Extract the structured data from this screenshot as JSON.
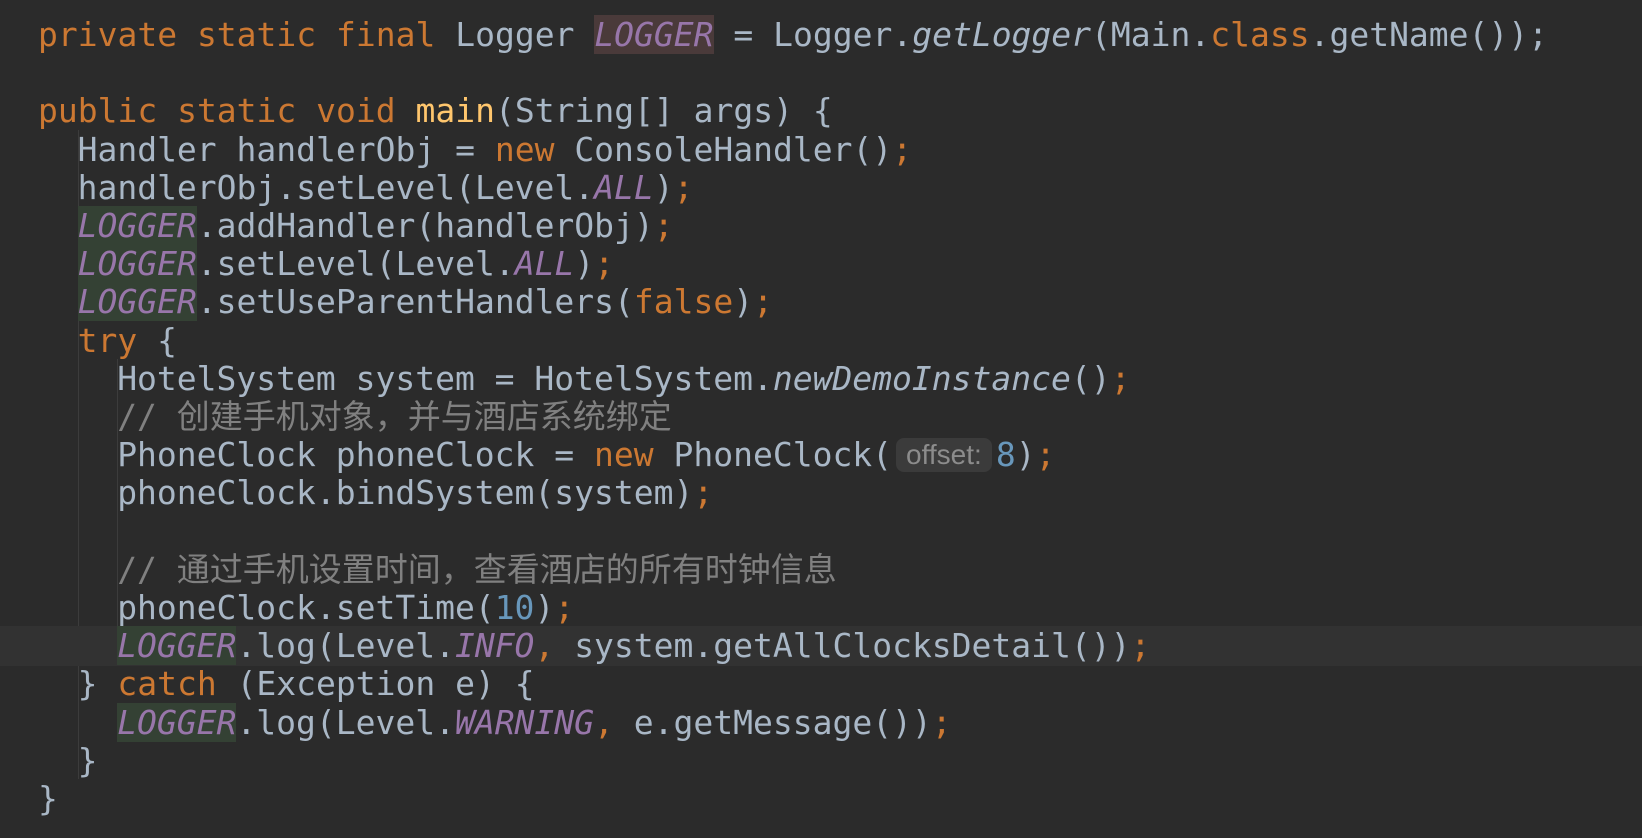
{
  "editor": {
    "lines": [
      {
        "indent": 1,
        "tokens": [
          {
            "t": "private static final ",
            "c": "kw"
          },
          {
            "t": "Logger ",
            "c": "pl"
          },
          {
            "t": "LOGGER",
            "c": "st-decl"
          },
          {
            "t": " = Logger.",
            "c": "pl"
          },
          {
            "t": "getLogger",
            "c": "it"
          },
          {
            "t": "(Main.",
            "c": "pl"
          },
          {
            "t": "class",
            "c": "kw"
          },
          {
            "t": ".getName());",
            "c": "pl"
          }
        ]
      },
      {
        "indent": 1,
        "tokens": []
      },
      {
        "indent": 1,
        "tokens": [
          {
            "t": "public static void ",
            "c": "kw"
          },
          {
            "t": "main",
            "c": "fn"
          },
          {
            "t": "(String[] args) {",
            "c": "pl"
          }
        ]
      },
      {
        "indent": 2,
        "tokens": [
          {
            "t": "Handler handlerObj = ",
            "c": "pl"
          },
          {
            "t": "new ",
            "c": "kw"
          },
          {
            "t": "ConsoleHandler()",
            "c": "pl"
          },
          {
            "t": ";",
            "c": "kw"
          }
        ]
      },
      {
        "indent": 2,
        "tokens": [
          {
            "t": "handlerObj.setLevel(Level.",
            "c": "pl"
          },
          {
            "t": "ALL",
            "c": "st"
          },
          {
            "t": ")",
            "c": "pl"
          },
          {
            "t": ";",
            "c": "kw"
          }
        ]
      },
      {
        "indent": 2,
        "tokens": [
          {
            "t": "LOGGER",
            "c": "st-hl"
          },
          {
            "t": ".addHandler(handlerObj)",
            "c": "pl"
          },
          {
            "t": ";",
            "c": "kw"
          }
        ]
      },
      {
        "indent": 2,
        "tokens": [
          {
            "t": "LOGGER",
            "c": "st-hl"
          },
          {
            "t": ".setLevel(Level.",
            "c": "pl"
          },
          {
            "t": "ALL",
            "c": "st"
          },
          {
            "t": ")",
            "c": "pl"
          },
          {
            "t": ";",
            "c": "kw"
          }
        ]
      },
      {
        "indent": 2,
        "tokens": [
          {
            "t": "LOGGER",
            "c": "st-hl"
          },
          {
            "t": ".setUseParentHandlers(",
            "c": "pl"
          },
          {
            "t": "false",
            "c": "kw"
          },
          {
            "t": ")",
            "c": "pl"
          },
          {
            "t": ";",
            "c": "kw"
          }
        ]
      },
      {
        "indent": 2,
        "tokens": [
          {
            "t": "try ",
            "c": "kw"
          },
          {
            "t": "{",
            "c": "pl"
          }
        ]
      },
      {
        "indent": 3,
        "tokens": [
          {
            "t": "HotelSystem system = HotelSystem.",
            "c": "pl"
          },
          {
            "t": "newDemoInstance",
            "c": "it"
          },
          {
            "t": "()",
            "c": "pl"
          },
          {
            "t": ";",
            "c": "kw"
          }
        ]
      },
      {
        "indent": 3,
        "tokens": [
          {
            "t": "// 创建手机对象，并与酒店系统绑定",
            "c": "cm"
          }
        ]
      },
      {
        "indent": 3,
        "tokens": [
          {
            "t": "PhoneClock phoneClock = ",
            "c": "pl"
          },
          {
            "t": "new ",
            "c": "kw"
          },
          {
            "t": "PhoneClock(",
            "c": "pl"
          },
          {
            "t": "offset:",
            "c": "hint"
          },
          {
            "t": "8",
            "c": "nm"
          },
          {
            "t": ")",
            "c": "pl"
          },
          {
            "t": ";",
            "c": "kw"
          }
        ]
      },
      {
        "indent": 3,
        "tokens": [
          {
            "t": "phoneClock.bindSystem(system)",
            "c": "pl"
          },
          {
            "t": ";",
            "c": "kw"
          }
        ]
      },
      {
        "indent": 3,
        "tokens": []
      },
      {
        "indent": 3,
        "tokens": [
          {
            "t": "// 通过手机设置时间，查看酒店的所有时钟信息",
            "c": "cm"
          }
        ]
      },
      {
        "indent": 3,
        "tokens": [
          {
            "t": "phoneClock.setTime(",
            "c": "pl"
          },
          {
            "t": "10",
            "c": "nm"
          },
          {
            "t": ")",
            "c": "pl"
          },
          {
            "t": ";",
            "c": "kw"
          }
        ]
      },
      {
        "indent": 3,
        "current": true,
        "tokens": [
          {
            "t": "LOGGER",
            "c": "st-hl"
          },
          {
            "t": ".log(Level.",
            "c": "pl"
          },
          {
            "t": "INFO",
            "c": "st"
          },
          {
            "t": ", ",
            "c": "kw"
          },
          {
            "t": "system.getAllClocksDetail())",
            "c": "pl"
          },
          {
            "t": ";",
            "c": "kw"
          }
        ]
      },
      {
        "indent": 2,
        "tokens": [
          {
            "t": "} ",
            "c": "pl"
          },
          {
            "t": "catch ",
            "c": "kw"
          },
          {
            "t": "(Exception e) {",
            "c": "pl"
          }
        ]
      },
      {
        "indent": 3,
        "tokens": [
          {
            "t": "LOGGER",
            "c": "st-hl"
          },
          {
            "t": ".log(Level.",
            "c": "pl"
          },
          {
            "t": "WARNING",
            "c": "st"
          },
          {
            "t": ", ",
            "c": "kw"
          },
          {
            "t": "e.getMessage())",
            "c": "pl"
          },
          {
            "t": ";",
            "c": "kw"
          }
        ]
      },
      {
        "indent": 2,
        "tokens": [
          {
            "t": "}",
            "c": "pl"
          }
        ]
      },
      {
        "indent": 1,
        "tokens": [
          {
            "t": "}",
            "c": "pl"
          }
        ]
      }
    ]
  }
}
